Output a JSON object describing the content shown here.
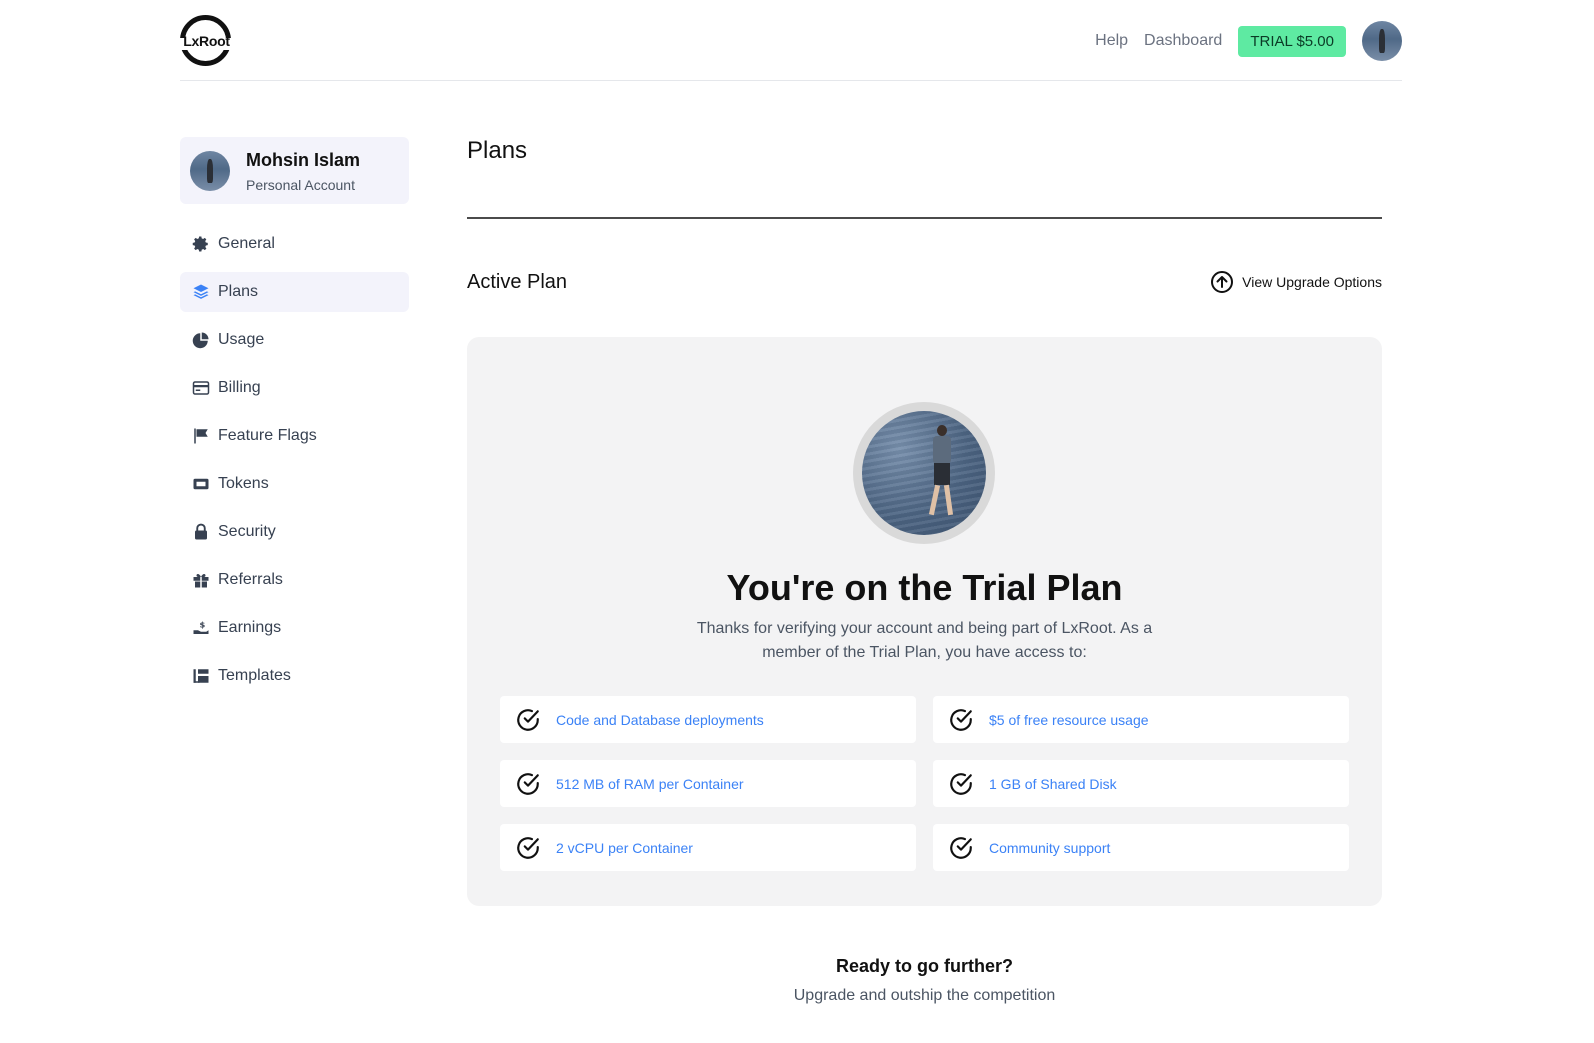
{
  "header": {
    "logo_text": "LxRoot",
    "nav": [
      {
        "label": "Help"
      },
      {
        "label": "Dashboard"
      }
    ],
    "trial_badge": "TRIAL $5.00",
    "colors": {
      "badge_bg": "#5eeaa2",
      "accent": "#3b82f6"
    }
  },
  "profile": {
    "name": "Mohsin Islam",
    "account_type": "Personal Account"
  },
  "sidebar": {
    "items": [
      {
        "label": "General",
        "icon": "gear-icon"
      },
      {
        "label": "Plans",
        "icon": "layers-icon",
        "active": true
      },
      {
        "label": "Usage",
        "icon": "pie-chart-icon"
      },
      {
        "label": "Billing",
        "icon": "credit-card-icon"
      },
      {
        "label": "Feature Flags",
        "icon": "flag-icon"
      },
      {
        "label": "Tokens",
        "icon": "ticket-icon"
      },
      {
        "label": "Security",
        "icon": "lock-icon"
      },
      {
        "label": "Referrals",
        "icon": "gift-icon"
      },
      {
        "label": "Earnings",
        "icon": "hand-dollar-icon"
      },
      {
        "label": "Templates",
        "icon": "templates-icon"
      }
    ]
  },
  "main": {
    "title": "Plans",
    "active_plan_heading": "Active Plan",
    "upgrade_link": "View Upgrade Options",
    "plan_card": {
      "title": "You're on the Trial Plan",
      "description": "Thanks for verifying your account and being part of LxRoot. As a member of the Trial Plan, you have access to:",
      "features": [
        "Code and Database deployments",
        "$5 of free resource usage",
        "512 MB of RAM per Container",
        "1 GB of Shared Disk",
        "2 vCPU per Container",
        "Community support"
      ]
    },
    "ready": {
      "title": "Ready to go further?",
      "subtitle": "Upgrade and outship the competition"
    }
  }
}
